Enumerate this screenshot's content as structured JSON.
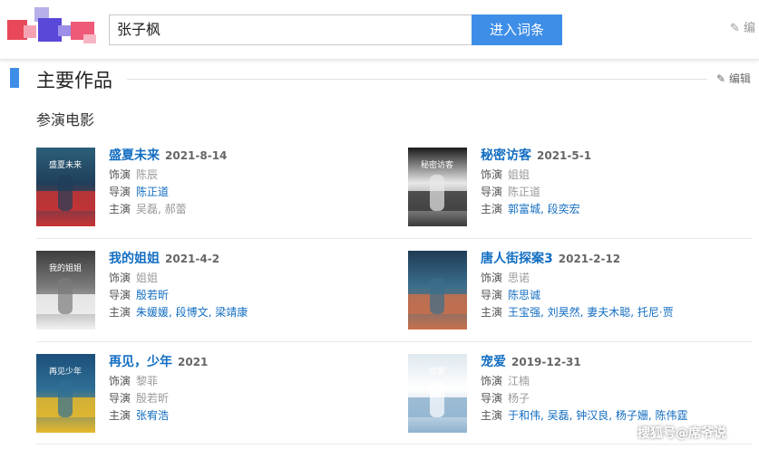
{
  "search": {
    "value": "张子枫",
    "button_label": "进入词条"
  },
  "top_edit_label": "编",
  "section": {
    "title": "主要作品",
    "edit_label": "编辑",
    "subtitle": "参演电影"
  },
  "films": [
    {
      "title": "盛夏未来",
      "date": "2021-8-14",
      "role_label": "饰演",
      "role": "陈辰",
      "director_label": "导演",
      "director": "陈正道",
      "cast_label": "主演",
      "cast": "吴磊, 郝蕾",
      "director_link": true,
      "cast_link": false
    },
    {
      "title": "秘密访客",
      "date": "2021-5-1",
      "role_label": "饰演",
      "role": "姐姐",
      "director_label": "导演",
      "director": "陈正道",
      "cast_label": "主演",
      "cast": "郭富城, 段奕宏",
      "director_link": false,
      "cast_link": true
    },
    {
      "title": "我的姐姐",
      "date": "2021-4-2",
      "role_label": "饰演",
      "role": "姐姐",
      "director_label": "导演",
      "director": "殷若昕",
      "cast_label": "主演",
      "cast": "朱媛媛, 段博文, 梁靖康",
      "director_link": true,
      "cast_link": true
    },
    {
      "title": "唐人街探案3",
      "date": "2021-2-12",
      "role_label": "饰演",
      "role": "思诺",
      "director_label": "导演",
      "director": "陈思诚",
      "cast_label": "主演",
      "cast": "王宝强, 刘昊然, 妻夫木聪, 托尼·贾",
      "director_link": true,
      "cast_link": true
    },
    {
      "title": "再见，少年",
      "date": "2021",
      "role_label": "饰演",
      "role": "黎菲",
      "director_label": "导演",
      "director": "殷若昕",
      "cast_label": "主演",
      "cast": "张宥浩",
      "director_link": false,
      "cast_link": true
    },
    {
      "title": "宠爱",
      "date": "2019-12-31",
      "role_label": "饰演",
      "role": "江楠",
      "director_label": "导演",
      "director": "杨子",
      "cast_label": "主演",
      "cast": "于和伟, 吴磊, 钟汉良, 杨子姗, 陈伟霆",
      "director_link": false,
      "cast_link": true
    }
  ],
  "posters": [
    {
      "text": "盛夏未来",
      "colors": [
        "#2c5f7a",
        "#c93434",
        "#1f3f5a"
      ]
    },
    {
      "text": "秘密访客",
      "colors": [
        "#1a1a1a",
        "#3a3a3a",
        "#e8e8e8"
      ]
    },
    {
      "text": "我的姐姐",
      "colors": [
        "#3d3d3d",
        "#f2f2f2",
        "#7a7a7a"
      ]
    },
    {
      "text": "",
      "colors": [
        "#1f3c55",
        "#c9704a",
        "#3a6e8c"
      ]
    },
    {
      "text": "再见少年",
      "colors": [
        "#1b4f7a",
        "#e8b82a",
        "#2f6f96"
      ]
    },
    {
      "text": "宠爱",
      "colors": [
        "#dfe8ef",
        "#8fb3cf",
        "#ffffff"
      ]
    }
  ],
  "watermark": "搜狐号@席爷说"
}
